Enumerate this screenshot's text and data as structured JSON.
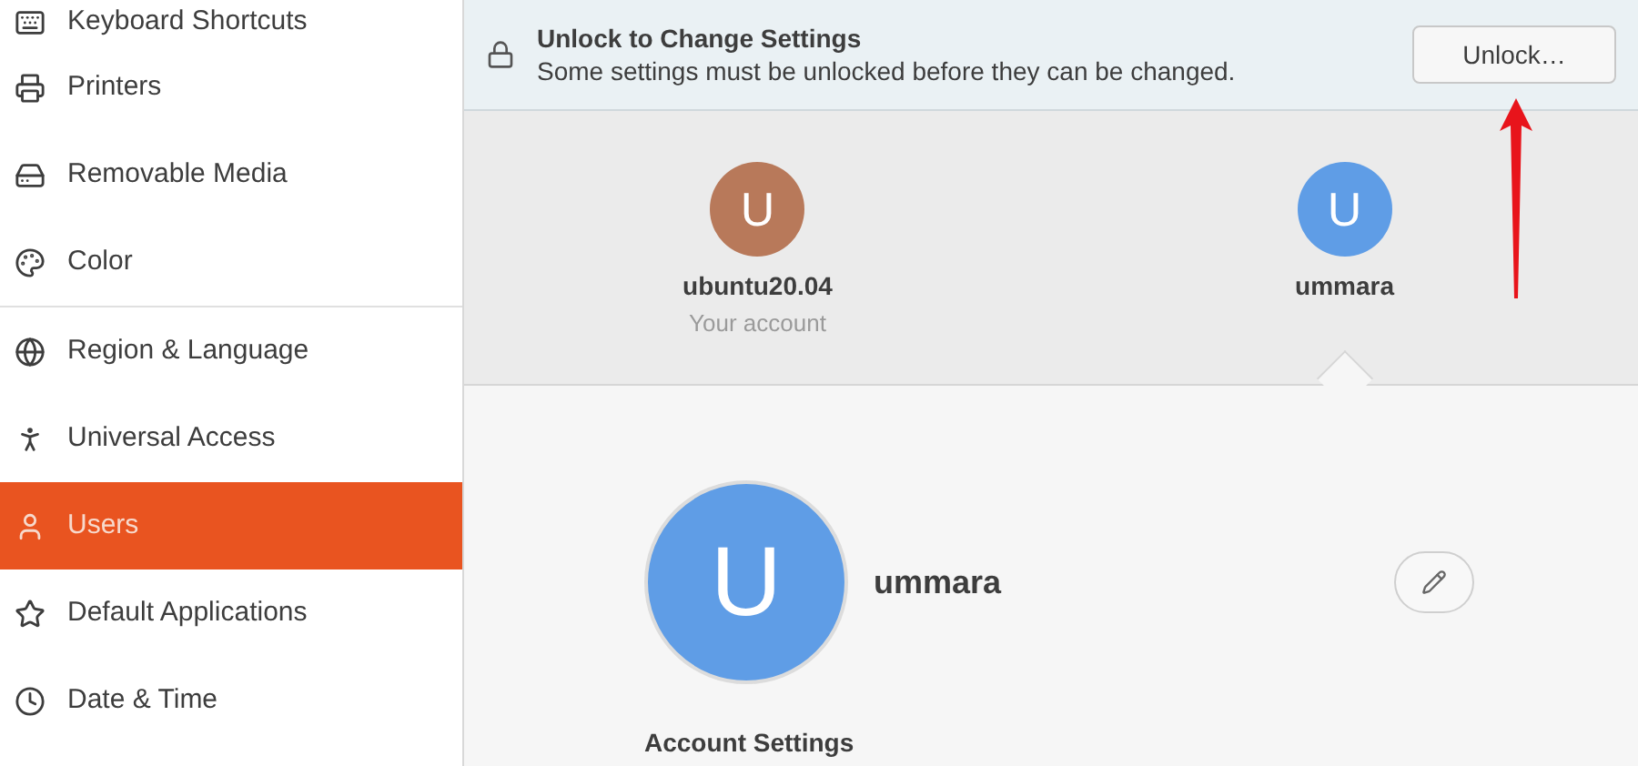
{
  "sidebar": {
    "items": [
      {
        "label": "Keyboard Shortcuts",
        "kind": "keyboard",
        "selected": false,
        "separator_after": false
      },
      {
        "label": "Printers",
        "kind": "printer",
        "selected": false,
        "separator_after": false
      },
      {
        "label": "Removable Media",
        "kind": "media",
        "selected": false,
        "separator_after": false
      },
      {
        "label": "Color",
        "kind": "color",
        "selected": false,
        "separator_after": true
      },
      {
        "label": "Region & Language",
        "kind": "globe",
        "selected": false,
        "separator_after": false
      },
      {
        "label": "Universal Access",
        "kind": "access",
        "selected": false,
        "separator_after": false
      },
      {
        "label": "Users",
        "kind": "user",
        "selected": true,
        "separator_after": false
      },
      {
        "label": "Default Applications",
        "kind": "star",
        "selected": false,
        "separator_after": false
      },
      {
        "label": "Date & Time",
        "kind": "clock",
        "selected": false,
        "separator_after": false
      }
    ]
  },
  "banner": {
    "title": "Unlock to Change Settings",
    "message": "Some settings must be unlocked before they can be changed.",
    "button": "Unlock…"
  },
  "users": [
    {
      "initial": "U",
      "name": "ubuntu20.04",
      "subtitle": "Your account",
      "color": "#b8795a",
      "selected": false
    },
    {
      "initial": "U",
      "name": "ummara",
      "color": "#5f9de6",
      "selected": true
    }
  ],
  "detail": {
    "initial": "U",
    "name": "ummara",
    "color": "#5f9de6",
    "section": "Account Settings"
  }
}
